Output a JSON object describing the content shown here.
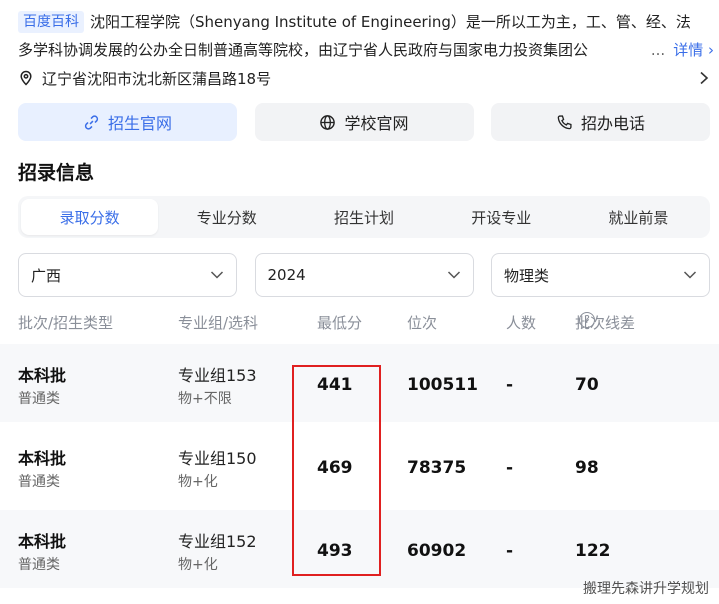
{
  "intro": {
    "source_tag": "百度百科",
    "line1": "沈阳工程学院（Shenyang Institute of Engineering）是一所以工为主，工、管、经、法",
    "line2": "多学科协调发展的公办全日制普通高等院校，由辽宁省人民政府与国家电力投资集团公",
    "ellipsis": "...",
    "detail_link": "详情",
    "detail_arrow": "›"
  },
  "address": {
    "text": "辽宁省沈阳市沈北新区蒲昌路18号",
    "icon": "location-pin-icon"
  },
  "actions": [
    {
      "label": "招生官网",
      "icon": "link-icon",
      "active": true
    },
    {
      "label": "学校官网",
      "icon": "globe-icon",
      "active": false
    },
    {
      "label": "招办电话",
      "icon": "phone-icon",
      "active": false
    }
  ],
  "section": {
    "title": "招录信息"
  },
  "tabs": [
    {
      "label": "录取分数",
      "active": true
    },
    {
      "label": "专业分数",
      "active": false
    },
    {
      "label": "招生计划",
      "active": false
    },
    {
      "label": "开设专业",
      "active": false
    },
    {
      "label": "就业前景",
      "active": false
    }
  ],
  "filters": [
    {
      "value": "广西"
    },
    {
      "value": "2024"
    },
    {
      "value": "物理类"
    }
  ],
  "table": {
    "headers": {
      "batch": "批次/招生类型",
      "group": "专业组/选科",
      "min_score": "最低分",
      "rank": "位次",
      "count": "人数",
      "diff": "批次线差",
      "help": "?"
    },
    "rows": [
      {
        "batch": "本科批",
        "type": "普通类",
        "group": "专业组153",
        "subjects": "物+不限",
        "min_score": "441",
        "rank": "100511",
        "count": "-",
        "diff": "70"
      },
      {
        "batch": "本科批",
        "type": "普通类",
        "group": "专业组150",
        "subjects": "物+化",
        "min_score": "469",
        "rank": "78375",
        "count": "-",
        "diff": "98"
      },
      {
        "batch": "本科批",
        "type": "普通类",
        "group": "专业组152",
        "subjects": "物+化",
        "min_score": "493",
        "rank": "60902",
        "count": "-",
        "diff": "122"
      }
    ]
  },
  "watermark": "搬理先森讲升学规划",
  "colors": {
    "accent": "#3a6ee8",
    "highlight_box": "#e02020"
  }
}
